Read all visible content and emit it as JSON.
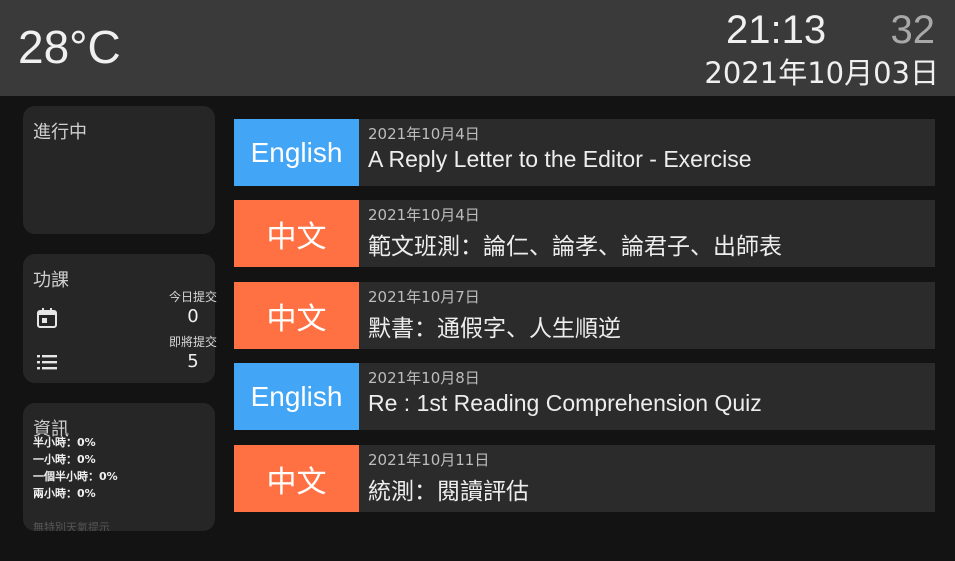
{
  "header": {
    "temperature": "28°C",
    "time": "21:13",
    "seconds": "32",
    "date": "2021年10月03日"
  },
  "progress_card": {
    "title": "進行中"
  },
  "homework_card": {
    "title": "功課",
    "today_label": "今日提交",
    "today_count": "0",
    "upcoming_label": "即將提交",
    "upcoming_count": "5",
    "icons": [
      "calendar-icon",
      "list-icon"
    ]
  },
  "info_card": {
    "title": "資訊",
    "lines": [
      "半小時：0%",
      "一小時：0%",
      "一個半小時：0%",
      "兩小時：0%"
    ],
    "faded_text": "無特別天氣提示"
  },
  "colors": {
    "english": "#42a5f5",
    "chinese": "#ff7043"
  },
  "tasks": [
    {
      "subject": "English",
      "date": "2021年10月4日",
      "title": "A Reply Letter to the Editor - Exercise"
    },
    {
      "subject": "中文",
      "date": "2021年10月4日",
      "title": "範文班測：論仁、論孝、論君子、出師表"
    },
    {
      "subject": "中文",
      "date": "2021年10月7日",
      "title": "默書：通假字、人生順逆"
    },
    {
      "subject": "English",
      "date": "2021年10月8日",
      "title": "Re : 1st Reading Comprehension Quiz"
    },
    {
      "subject": "中文",
      "date": "2021年10月11日",
      "title": "統測：閱讀評估"
    }
  ]
}
